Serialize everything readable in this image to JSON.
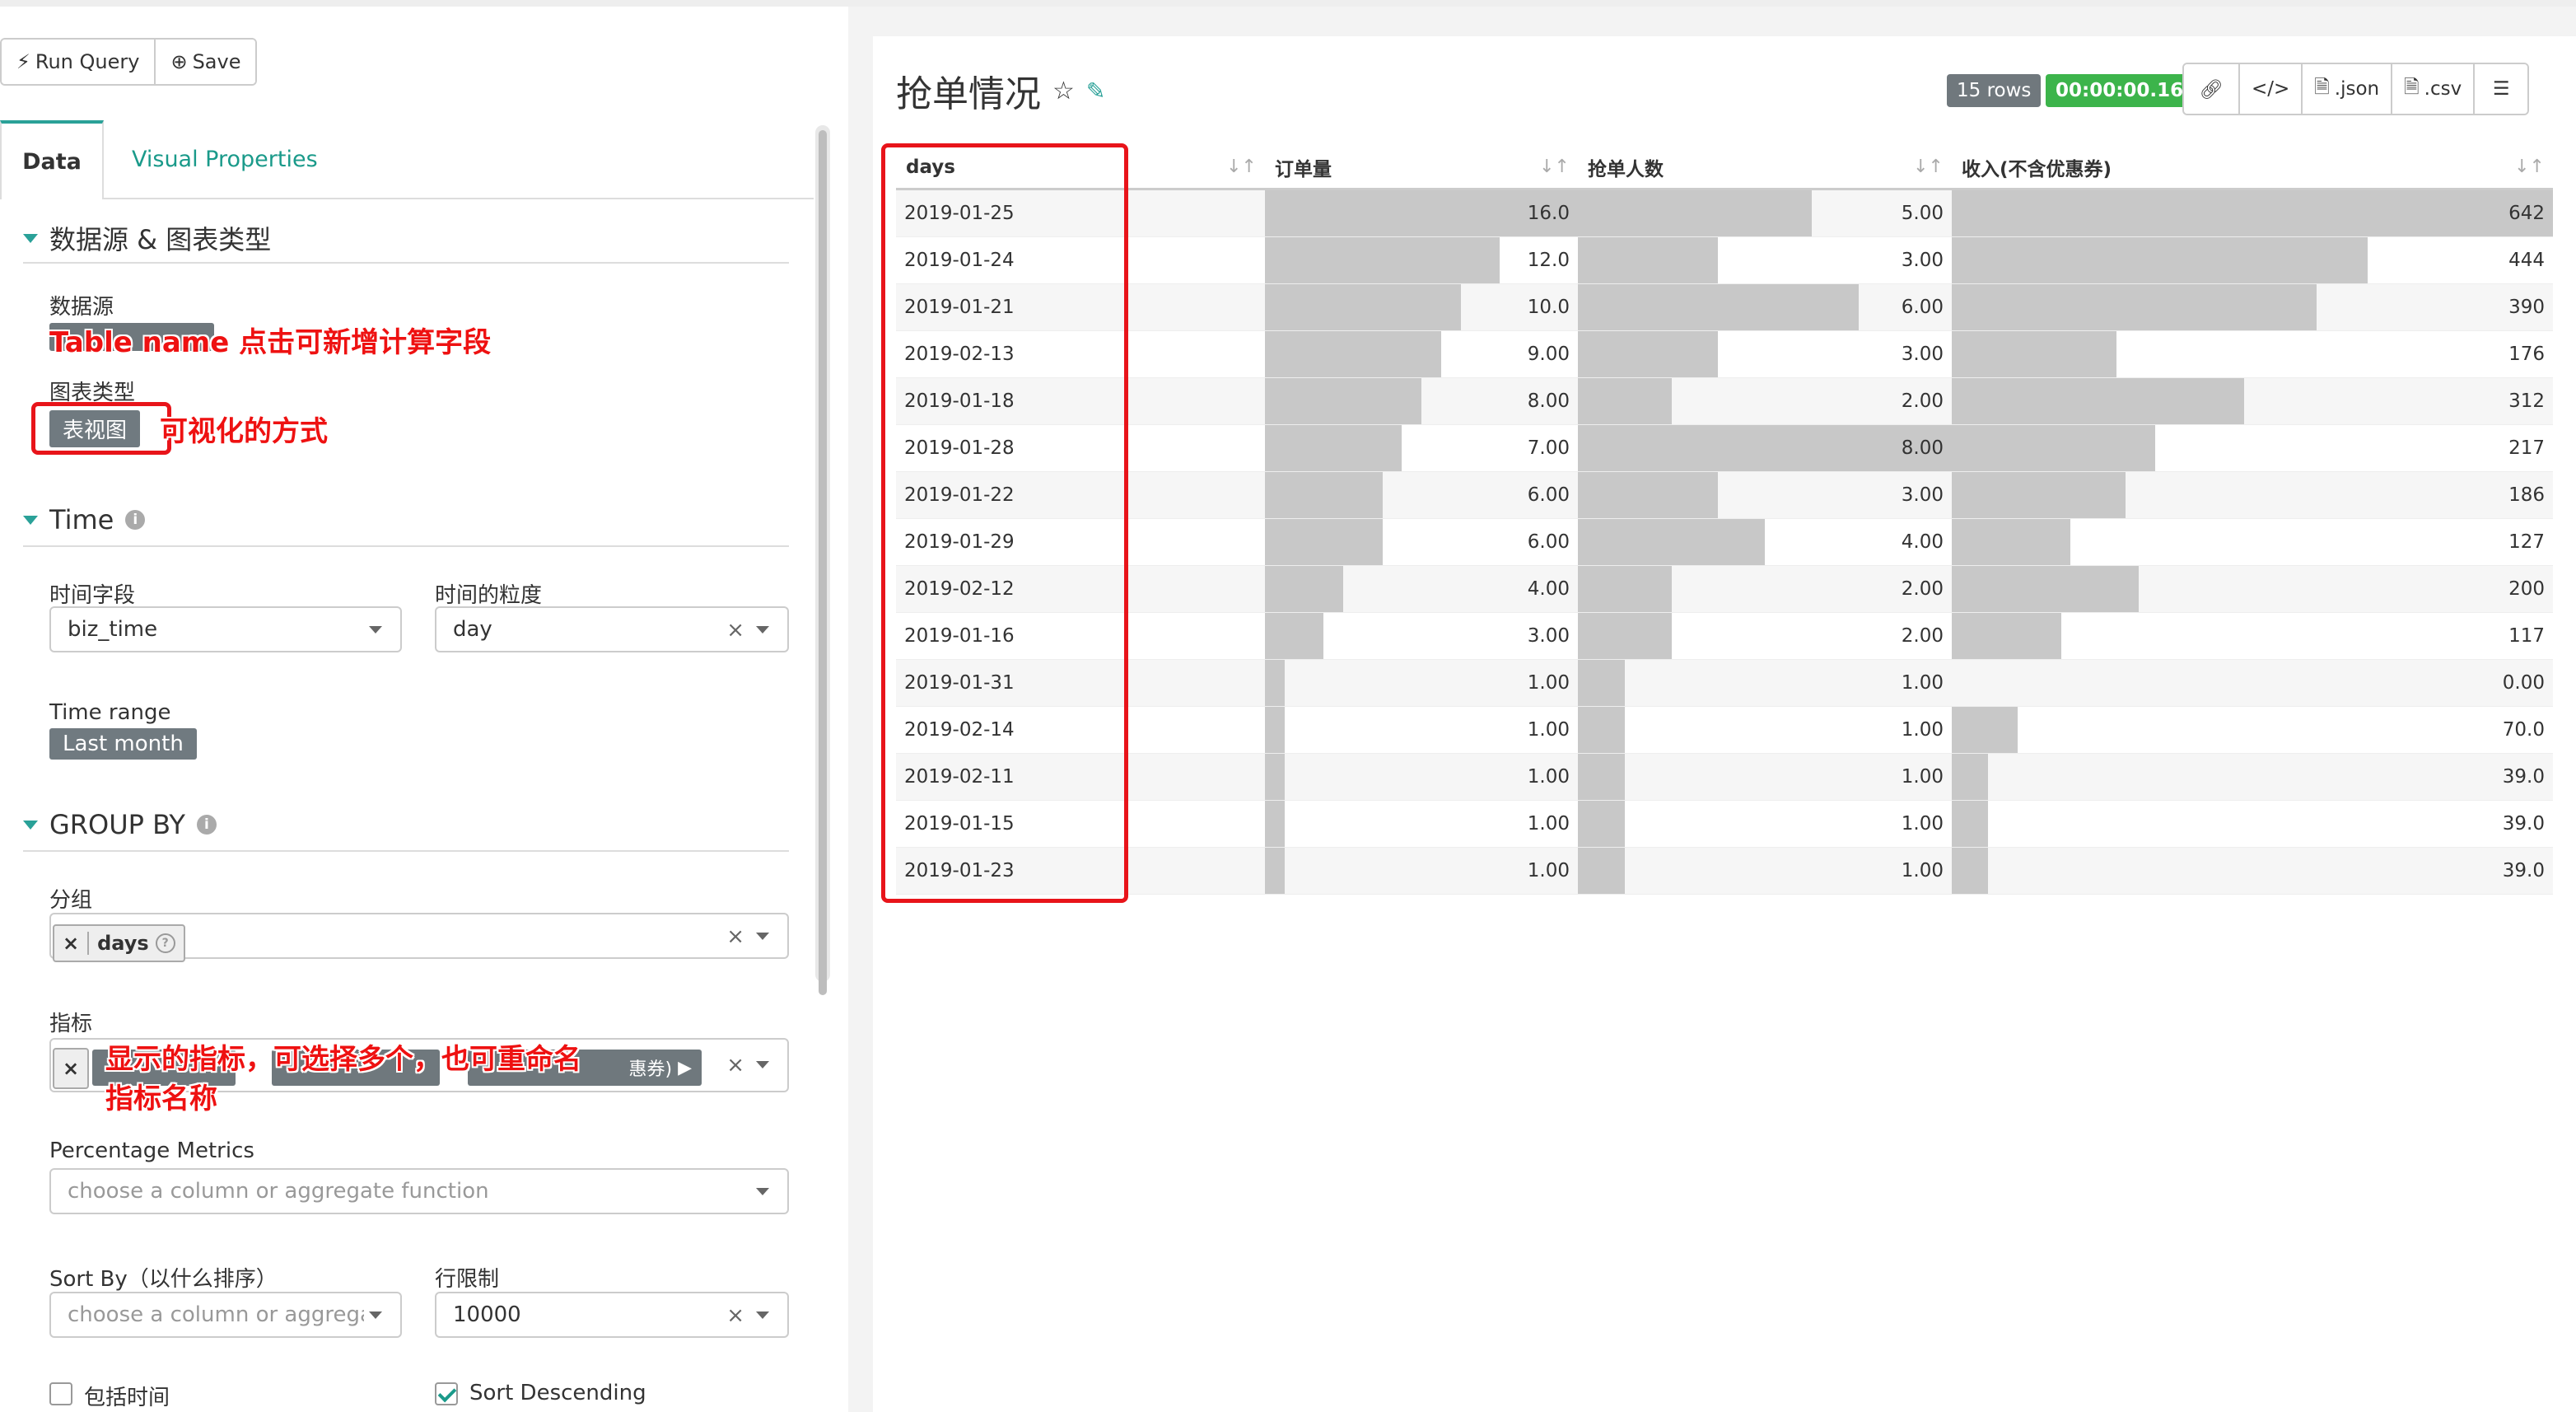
{
  "toolbar": {
    "run_label": "Run Query",
    "save_label": "Save"
  },
  "tabs": {
    "data": "Data",
    "visual": "Visual Properties"
  },
  "sections": {
    "datasource": "数据源 & 图表类型",
    "time": "Time",
    "groupby": "GROUP BY"
  },
  "datasource": {
    "label": "数据源",
    "viz_label": "图表类型",
    "viz_value": "表视图"
  },
  "time": {
    "field_label": "时间字段",
    "field_value": "biz_time",
    "grain_label": "时间的粒度",
    "grain_value": "day",
    "range_label": "Time range",
    "range_value": "Last month"
  },
  "groupby": {
    "group_label": "分组",
    "group_tag": "days",
    "metrics_label": "指标",
    "metric_fragment": "惠券)",
    "pct_label": "Percentage Metrics",
    "pct_placeholder": "choose a column or aggregate function",
    "sortby_label": "Sort By（以什么排序）",
    "sortby_placeholder": "choose a column or aggrega...",
    "limit_label": "行限制",
    "limit_value": "10000",
    "include_time_label": "包括时间",
    "sort_desc_label": "Sort Descending"
  },
  "annotations": {
    "table_name": "Table name 点击可新增计算字段",
    "viz_type": "可视化的方式",
    "metrics": "显示的指标，可选择多个，也可重命名",
    "metrics_2": "指标名称"
  },
  "chart": {
    "title": "抢单情况",
    "rows_badge": "15 rows",
    "time_badge": "00:00:00.16",
    "json_label": ".json",
    "csv_label": ".csv"
  },
  "table": {
    "columns": [
      "days",
      "订单量",
      "抢单人数",
      "收入(不含优惠券)"
    ],
    "rows": [
      {
        "day": "2019-01-25",
        "orders": "16.0",
        "people": "5.00",
        "income": "642"
      },
      {
        "day": "2019-01-24",
        "orders": "12.0",
        "people": "3.00",
        "income": "444"
      },
      {
        "day": "2019-01-21",
        "orders": "10.0",
        "people": "6.00",
        "income": "390"
      },
      {
        "day": "2019-02-13",
        "orders": "9.00",
        "people": "3.00",
        "income": "176"
      },
      {
        "day": "2019-01-18",
        "orders": "8.00",
        "people": "2.00",
        "income": "312"
      },
      {
        "day": "2019-01-28",
        "orders": "7.00",
        "people": "8.00",
        "income": "217"
      },
      {
        "day": "2019-01-22",
        "orders": "6.00",
        "people": "3.00",
        "income": "186"
      },
      {
        "day": "2019-01-29",
        "orders": "6.00",
        "people": "4.00",
        "income": "127"
      },
      {
        "day": "2019-02-12",
        "orders": "4.00",
        "people": "2.00",
        "income": "200"
      },
      {
        "day": "2019-01-16",
        "orders": "3.00",
        "people": "2.00",
        "income": "117"
      },
      {
        "day": "2019-01-31",
        "orders": "1.00",
        "people": "1.00",
        "income": "0.00"
      },
      {
        "day": "2019-02-14",
        "orders": "1.00",
        "people": "1.00",
        "income": "70.0"
      },
      {
        "day": "2019-02-11",
        "orders": "1.00",
        "people": "1.00",
        "income": "39.0"
      },
      {
        "day": "2019-01-15",
        "orders": "1.00",
        "people": "1.00",
        "income": "39.0"
      },
      {
        "day": "2019-01-23",
        "orders": "1.00",
        "people": "1.00",
        "income": "39.0"
      }
    ],
    "max": {
      "orders": 16,
      "people": 8,
      "income": 642
    }
  },
  "colors": {
    "accent": "#2aa198",
    "annotation": "#e8141a",
    "bar": "#c8c8c8",
    "success": "#3cb44b"
  },
  "icons": [
    "bolt-icon",
    "plus-circle-icon",
    "info-icon",
    "question-icon",
    "star-icon",
    "edit-icon",
    "link-icon",
    "code-icon",
    "file-icon",
    "menu-icon",
    "sort-icon",
    "caret-down-icon",
    "close-icon"
  ]
}
